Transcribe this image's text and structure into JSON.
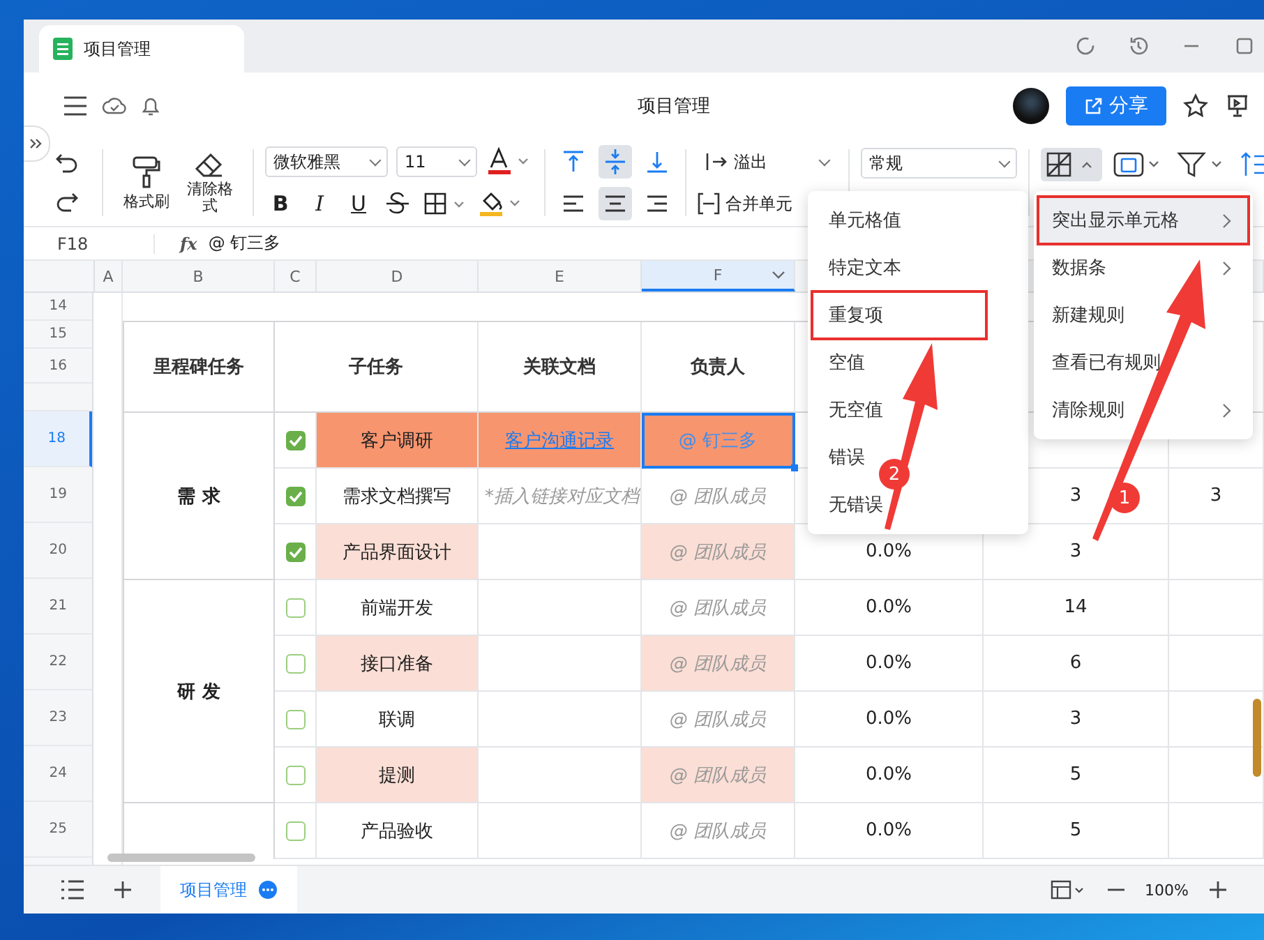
{
  "window": {
    "tab_title": "项目管理",
    "title": "项目管理",
    "share_button": "分享"
  },
  "toolbar": {
    "format_painter": "格式刷",
    "clear_format": "清除格式",
    "font": "微软雅黑",
    "font_size": "11",
    "bold": "B",
    "italic": "I",
    "underline": "U",
    "wrap": "溢出",
    "merge": "合并单元",
    "number_format": "常规"
  },
  "formula_bar": {
    "cell": "F18",
    "fx": "fx",
    "value": "@ 钉三多"
  },
  "columns": [
    {
      "label": "A",
      "selected": false
    },
    {
      "label": "B",
      "selected": false
    },
    {
      "label": "C",
      "selected": false
    },
    {
      "label": "D",
      "selected": false
    },
    {
      "label": "E",
      "selected": false
    },
    {
      "label": "F",
      "selected": true
    }
  ],
  "row_numbers": [
    {
      "label": "14",
      "selected": false
    },
    {
      "label": "15",
      "selected": false
    },
    {
      "label": "16",
      "selected": false
    },
    {
      "label": "18",
      "selected": true
    },
    {
      "label": "19",
      "selected": false
    },
    {
      "label": "20",
      "selected": false
    },
    {
      "label": "21",
      "selected": false
    },
    {
      "label": "22",
      "selected": false
    },
    {
      "label": "23",
      "selected": false
    },
    {
      "label": "24",
      "selected": false
    },
    {
      "label": "25",
      "selected": false
    }
  ],
  "table": {
    "headers": [
      "里程碑任务",
      "子任务",
      "关联文档",
      "负责人"
    ],
    "groups": [
      {
        "name": "需 求",
        "rows": [
          {
            "done": true,
            "task": "客户调研",
            "strong": true,
            "doc": {
              "kind": "link",
              "text": "客户沟通记录"
            },
            "owner": {
              "kind": "mention",
              "text": "@ 钉三多"
            },
            "selected": true
          },
          {
            "done": true,
            "task": "需求文档撰写",
            "strong": false,
            "highlight": false,
            "doc": {
              "kind": "placeholder",
              "text": "*插入链接对应文档"
            },
            "owner": {
              "kind": "placeholder",
              "text": "@ 团队成员"
            },
            "selected": false,
            "days": "3",
            "col_i": "3"
          },
          {
            "done": true,
            "task": "产品界面设计",
            "strong": false,
            "highlight": true,
            "owner": {
              "kind": "placeholder",
              "text": "@ 团队成员"
            },
            "selected": false,
            "progress": "0.0%",
            "days": "3"
          }
        ]
      },
      {
        "name": "研 发",
        "rows": [
          {
            "done": false,
            "task": "前端开发",
            "strong": false,
            "highlight": false,
            "owner": {
              "kind": "placeholder",
              "text": "@ 团队成员"
            },
            "selected": false,
            "progress": "0.0%",
            "days": "14"
          },
          {
            "done": false,
            "task": "接口准备",
            "strong": false,
            "highlight": true,
            "owner": {
              "kind": "placeholder",
              "text": "@ 团队成员"
            },
            "selected": false,
            "progress": "0.0%",
            "days": "6"
          },
          {
            "done": false,
            "task": "联调",
            "strong": false,
            "highlight": false,
            "owner": {
              "kind": "placeholder",
              "text": "@ 团队成员"
            },
            "selected": false,
            "progress": "0.0%",
            "days": "3"
          },
          {
            "done": false,
            "task": "提测",
            "strong": false,
            "highlight": true,
            "owner": {
              "kind": "placeholder",
              "text": "@ 团队成员"
            },
            "selected": false,
            "progress": "0.0%",
            "days": "5"
          }
        ]
      },
      {
        "rows": [
          {
            "done": false,
            "task": "产品验收",
            "strong": false,
            "highlight": false,
            "owner": {
              "kind": "placeholder",
              "text": "@ 团队成员"
            },
            "selected": false,
            "progress": "0.0%",
            "days": "5"
          }
        ]
      }
    ]
  },
  "menus": [
    {
      "items": [
        {
          "label": "单元格值",
          "selected": false,
          "submenu": false,
          "boxed": false
        },
        {
          "label": "特定文本",
          "selected": false,
          "submenu": false,
          "boxed": false
        },
        {
          "label": "重复项",
          "selected": false,
          "submenu": false,
          "boxed": true
        },
        {
          "label": "空值",
          "selected": false,
          "submenu": false,
          "boxed": false
        },
        {
          "label": "无空值",
          "selected": false,
          "submenu": false,
          "boxed": false
        },
        {
          "label": "错误",
          "selected": false,
          "submenu": false,
          "boxed": false
        },
        {
          "label": "无错误",
          "selected": false,
          "submenu": false,
          "boxed": false
        }
      ]
    },
    {
      "items": [
        {
          "label": "突出显示单元格",
          "selected": true,
          "submenu": true,
          "boxed": true
        },
        {
          "label": "数据条",
          "selected": false,
          "submenu": true,
          "boxed": false
        },
        {
          "label": "新建规则",
          "selected": false,
          "submenu": false,
          "boxed": false
        },
        {
          "label": "查看已有规则",
          "selected": false,
          "submenu": false,
          "boxed": false
        },
        {
          "label": "清除规则",
          "selected": false,
          "submenu": true,
          "boxed": false
        }
      ]
    }
  ],
  "annotations": [
    {
      "number": "1"
    },
    {
      "number": "2"
    }
  ],
  "sheet_tabs": [
    {
      "label": "项目管理",
      "selected": true
    }
  ],
  "zoom": "100%"
}
